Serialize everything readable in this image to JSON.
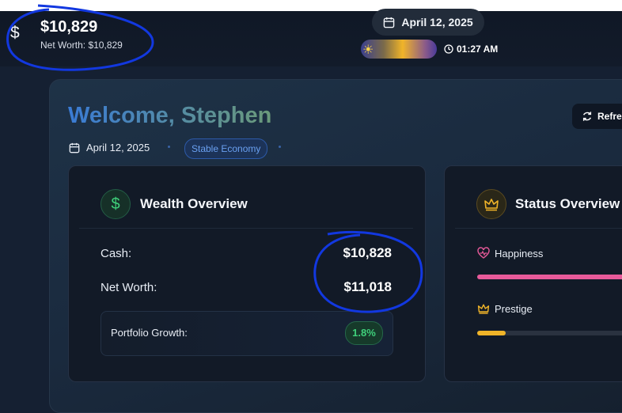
{
  "header": {
    "currency_icon": "dollar-icon",
    "balance": "$10,829",
    "net_worth": "Net Worth: $10,829",
    "date": "April 12, 2025",
    "time": "01:27 AM"
  },
  "dashboard": {
    "welcome": "Welcome, Stephen",
    "refresh_label": "Refresh",
    "date": "April 12, 2025",
    "economy_status": "Stable Economy"
  },
  "wealth": {
    "title": "Wealth Overview",
    "cash_label": "Cash:",
    "cash_value": "$10,828",
    "net_worth_label": "Net Worth:",
    "net_worth_value": "$11,018",
    "growth_label": "Portfolio Growth:",
    "growth_value": "1.8%"
  },
  "status": {
    "title": "Status Overview",
    "happiness_label": "Happiness",
    "happiness_level": 1.0,
    "prestige_label": "Prestige",
    "prestige_level": 0.18
  },
  "colors": {
    "accent_blue": "#3a7bd5",
    "green": "#3fcf7a",
    "gold": "#f0b429",
    "pink": "#e85a9a",
    "annotation": "#1238e0"
  }
}
